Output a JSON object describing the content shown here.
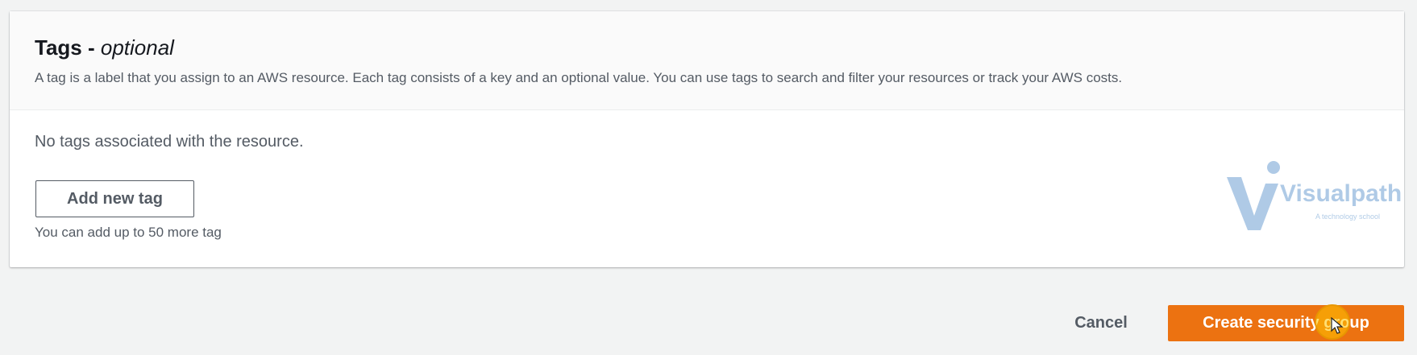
{
  "tags_panel": {
    "title": "Tags - ",
    "title_optional": "optional",
    "description": "A tag is a label that you assign to an AWS resource. Each tag consists of a key and an optional value. You can use tags to search and filter your resources or track your AWS costs.",
    "empty_message": "No tags associated with the resource.",
    "add_button_label": "Add new tag",
    "limit_message": "You can add up to 50 more tag"
  },
  "watermark": {
    "name": "Visualpath",
    "tagline": "A technology school"
  },
  "footer": {
    "cancel_label": "Cancel",
    "submit_label": "Create security group"
  },
  "colors": {
    "primary_button": "#ec7211",
    "page_background": "#f2f3f3",
    "watermark_blue": "#1e6bb8"
  },
  "icons": {
    "cursor": "cursor-arrow-icon",
    "watermark_logo": "visualpath-logo-icon"
  }
}
